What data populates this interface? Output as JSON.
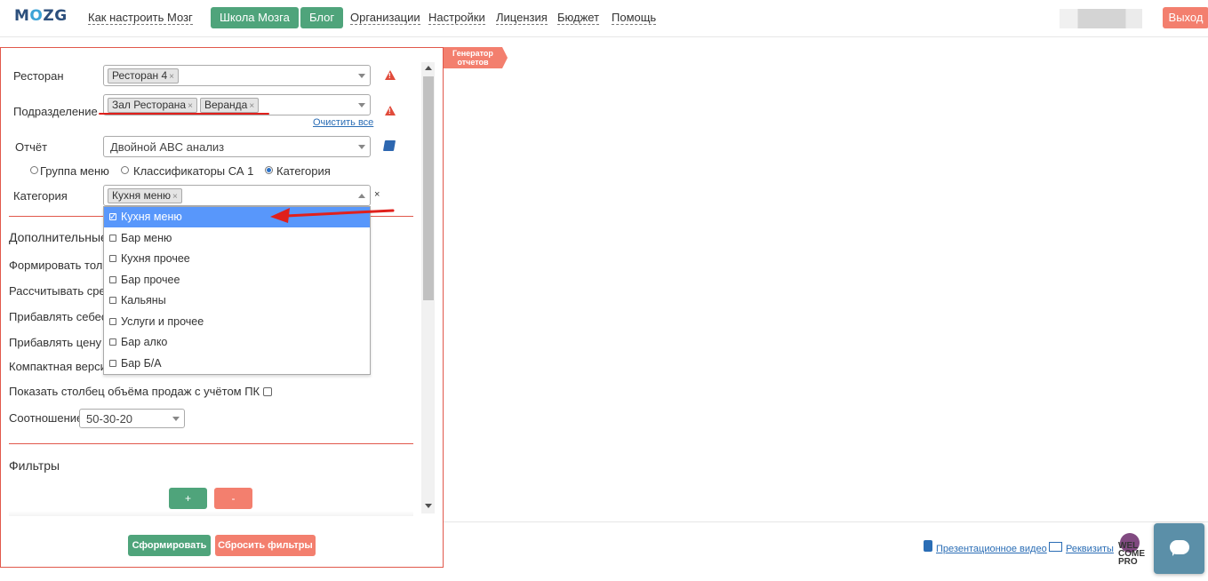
{
  "header": {
    "logo": "MOZG",
    "nav_links": [
      "Как настроить Мозг",
      "Организации",
      "Настройки",
      "Лицензия",
      "Бюджет",
      "Помощь"
    ],
    "nav_buttons": [
      "Школа Мозга",
      "Блог"
    ],
    "logout_label": "Выход"
  },
  "panel": {
    "ribbon": "Генератор отчетов",
    "restaurant": {
      "label": "Ресторан",
      "tags": [
        "Ресторан 4"
      ]
    },
    "subdivision": {
      "label": "Подразделение",
      "tags": [
        "Зал Ресторана",
        "Веранда"
      ],
      "clear_all": "Очистить все"
    },
    "report": {
      "label": "Отчёт",
      "value": "Двойной ABC анализ"
    },
    "grouping": {
      "options": [
        "Группа меню",
        "Классификаторы СА 1",
        "Категория"
      ],
      "selected": "Категория"
    },
    "category": {
      "label": "Категория",
      "tags": [
        "Кухня меню"
      ],
      "clear": "×"
    },
    "category_options": [
      {
        "label": "Кухня меню",
        "checked": true
      },
      {
        "label": "Бар меню",
        "checked": false
      },
      {
        "label": "Кухня прочее",
        "checked": false
      },
      {
        "label": "Бар прочее",
        "checked": false
      },
      {
        "label": "Кальяны",
        "checked": false
      },
      {
        "label": "Услуги и прочее",
        "checked": false
      },
      {
        "label": "Бар алко",
        "checked": false
      },
      {
        "label": "Бар Б/А",
        "checked": false
      }
    ],
    "additional": {
      "heading": "Дополнительные",
      "rows": [
        "Формировать тольк",
        "Рассчитывать сред",
        "Прибавлять себесто",
        "Прибавлять цену мо",
        "Компактная версия"
      ],
      "show_volume": "Показать столбец объёма продаж с учётом ПК",
      "ratio_label": "Соотношение",
      "ratio_value": "50-30-20"
    },
    "filters": {
      "heading": "Фильтры",
      "add": "+",
      "remove": "-"
    },
    "actions": {
      "submit": "Сформировать",
      "reset": "Сбросить фильтры"
    }
  },
  "footer": {
    "video_link": "Презентационное видео",
    "requisites_link": "Реквизиты",
    "partner_logo": [
      "WEL",
      "COME",
      "PRO"
    ]
  },
  "colors": {
    "green": "#4fa47b",
    "salmon": "#f37f6e",
    "accent_red": "#e1584b",
    "select_blue": "#5897fb"
  }
}
